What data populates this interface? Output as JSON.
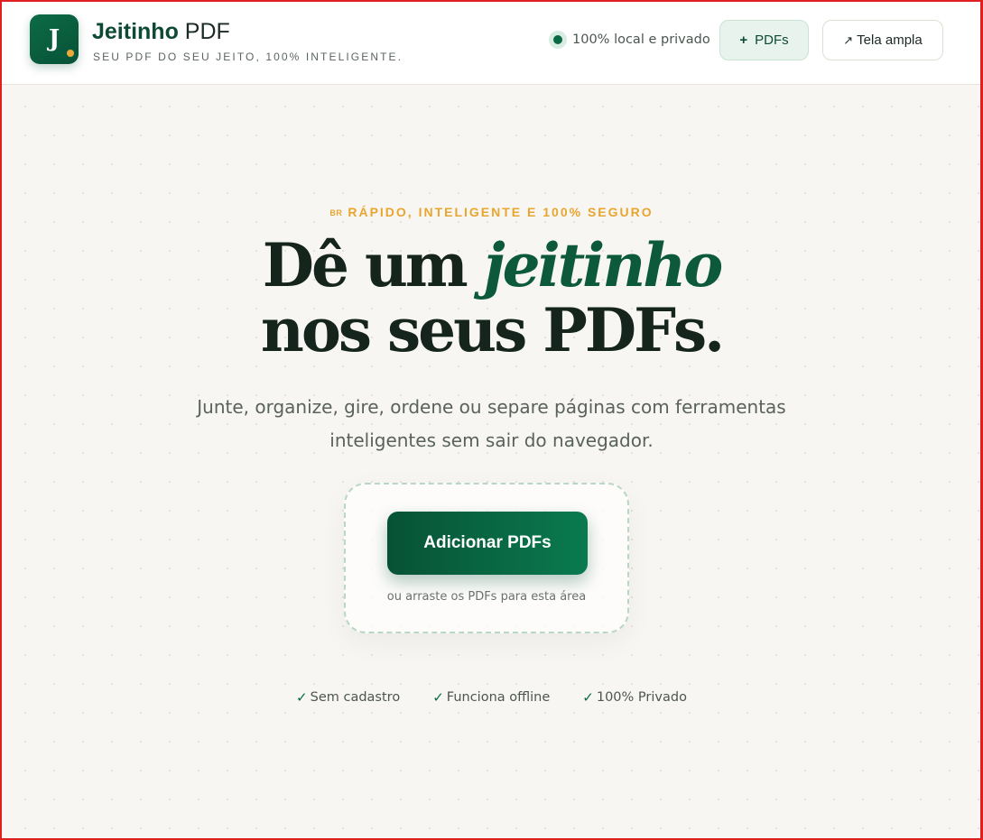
{
  "header": {
    "logo_letter": "J",
    "brand_name": "Jeitinho",
    "brand_suffix": "PDF",
    "tagline": "SEU PDF DO SEU JEITO, 100% INTELIGENTE.",
    "privacy_text": "100% local e privado",
    "pdfs_button": {
      "icon": "+",
      "label": "PDFs"
    },
    "wide_button": {
      "icon": "↗",
      "label": "Tela ampla"
    }
  },
  "hero": {
    "eyebrow_flag": "BR",
    "eyebrow": "RÁPIDO, INTELIGENTE E 100% SEGURO",
    "headline_line1_start": "Dê um",
    "headline_accent": "jeitinho",
    "headline_line2": "nos seus PDFs.",
    "lead_line1": "Junte, organize, gire, ordene ou separe páginas com ferramentas",
    "lead_line2": "inteligentes sem sair do navegador."
  },
  "dropzone": {
    "button_label": "Adicionar PDFs",
    "hint": "ou arraste os PDFs para esta área"
  },
  "features": [
    {
      "icon": "✓",
      "label": "Sem cadastro"
    },
    {
      "icon": "✓",
      "label": "Funciona offline"
    },
    {
      "icon": "✓",
      "label": "100% Privado"
    }
  ],
  "colors": {
    "brand_green": "#0c6b46",
    "accent_gold": "#e8a52f",
    "background": "#f8f6f2"
  }
}
